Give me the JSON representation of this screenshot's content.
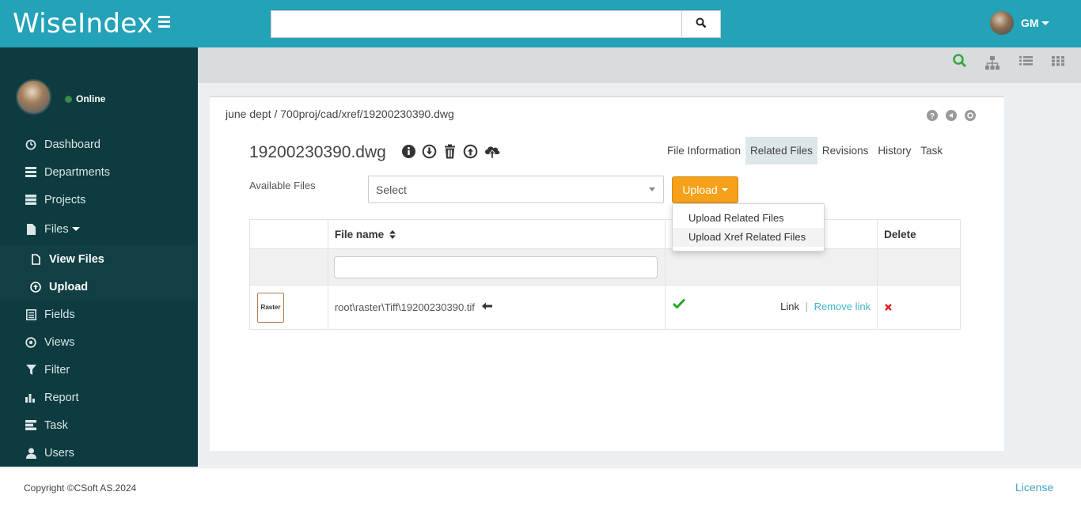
{
  "brand": "WiseIndex",
  "header": {
    "search_value": "",
    "user_initials": "GM"
  },
  "sidebar": {
    "status": "Online",
    "items": [
      {
        "label": "Dashboard",
        "icon": "dashboard-icon"
      },
      {
        "label": "Departments",
        "icon": "list-icon"
      },
      {
        "label": "Projects",
        "icon": "server-icon"
      },
      {
        "label": "Files",
        "icon": "file-icon"
      },
      {
        "label": "View Files",
        "icon": "file-outline-icon"
      },
      {
        "label": "Upload",
        "icon": "upload-circle-icon"
      },
      {
        "label": "Fields",
        "icon": "fields-icon"
      },
      {
        "label": "Views",
        "icon": "eye-circle-icon"
      },
      {
        "label": "Filter",
        "icon": "filter-icon"
      },
      {
        "label": "Report",
        "icon": "bar-chart-icon"
      },
      {
        "label": "Task",
        "icon": "tasks-icon"
      },
      {
        "label": "Users",
        "icon": "user-icon"
      }
    ]
  },
  "breadcrumb": "june dept / 700proj/cad/xref/19200230390.dwg",
  "file": {
    "title": "19200230390.dwg"
  },
  "tabs": [
    {
      "label": "File Information",
      "active": false
    },
    {
      "label": "Related Files",
      "active": true
    },
    {
      "label": "Revisions",
      "active": false
    },
    {
      "label": "History",
      "active": false
    },
    {
      "label": "Task",
      "active": false
    }
  ],
  "available_files": {
    "label": "Available Files",
    "placeholder": "Select"
  },
  "upload": {
    "label": "Upload",
    "menu": [
      "Upload Related Files",
      "Upload Xref Related Files"
    ]
  },
  "table": {
    "headers": [
      "",
      "File name",
      "",
      "Delete"
    ],
    "rows": [
      {
        "thumb": "Raster",
        "filename": "root\\raster\\Tiff\\19200230390.tif",
        "link": "Link",
        "separator": "|",
        "remove": "Remove link"
      }
    ]
  },
  "footer": {
    "copyright": "Copyright ©CSoft AS.2024",
    "license": "License"
  },
  "colors": {
    "topbar": "#23a2b8",
    "sidebar": "#0d3b3f",
    "accent_orange": "#f5a11a",
    "link_teal": "#3fb6c8",
    "check_green": "#2aa52a",
    "delete_red": "#e02020"
  }
}
